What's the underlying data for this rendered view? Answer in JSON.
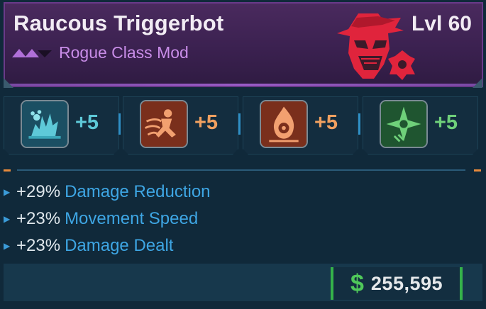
{
  "item": {
    "name": "Raucous Triggerbot",
    "level": "Lvl 60",
    "type": "Rogue Class Mod",
    "rarity_color": "#c98de8",
    "class_emblem_icon": "masked-vigilante-emblem-icon"
  },
  "skills": [
    {
      "icon": "cyan-crystal-burst-icon",
      "value": "+5",
      "color": "#5ec9d8"
    },
    {
      "icon": "orange-dash-figure-icon",
      "value": "+5",
      "color": "#f0a060"
    },
    {
      "icon": "orange-flame-emblem-icon",
      "value": "+5",
      "color": "#f0a060"
    },
    {
      "icon": "green-shuriken-icon",
      "value": "+5",
      "color": "#6fd07a"
    }
  ],
  "stats": [
    {
      "amount": "+29%",
      "name": "Damage Reduction"
    },
    {
      "amount": "+23%",
      "name": "Movement Speed"
    },
    {
      "amount": "+23%",
      "name": "Damage Dealt"
    }
  ],
  "price": {
    "currency_icon": "dollar-sign-icon",
    "value": "255,595",
    "accent": "#35b24a"
  }
}
